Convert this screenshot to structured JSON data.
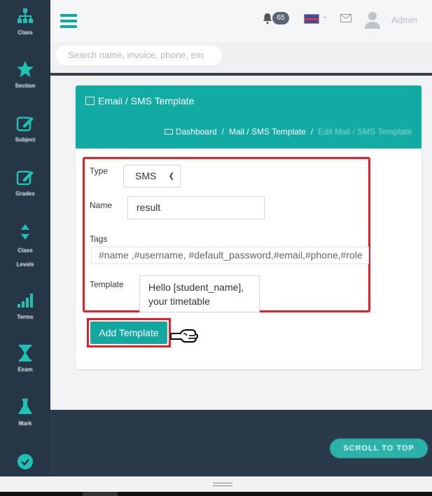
{
  "sidebar": {
    "items": [
      {
        "label": "Class",
        "icon": "class-hierarchy-icon"
      },
      {
        "label": "Section",
        "icon": "star-icon"
      },
      {
        "label": "Subject",
        "icon": "edit-icon"
      },
      {
        "label": "Grades",
        "icon": "edit-icon"
      },
      {
        "label_line1": "Class",
        "label_line2": "Levels",
        "icon": "sort-arrows-icon"
      },
      {
        "label": "Terms",
        "icon": "signal-bars-icon"
      },
      {
        "label": "Exam",
        "icon": "hourglass-icon"
      },
      {
        "label": "Mark",
        "icon": "flask-icon"
      },
      {
        "icon": "check-circle-icon"
      }
    ]
  },
  "topbar": {
    "notification_count": "65",
    "admin_label": "Admin",
    "accent_color": "#14a7a0"
  },
  "search": {
    "placeholder": "Search name, invoice, phone, em"
  },
  "card": {
    "title": "Email / SMS Template",
    "breadcrumb": {
      "dashboard": "Dashboard",
      "mail": "Mail / SMS Template",
      "current": "Edit Mail / SMS Template",
      "separator": "/"
    }
  },
  "form": {
    "type_label": "Type",
    "type_value": "SMS",
    "name_label": "Name",
    "name_value": "result",
    "tags_label": "Tags",
    "tags_value": "#name ,#username, #default_password,#email,#phone,#role",
    "template_label": "Template",
    "template_line1": "Hello [student_name],",
    "template_line2": "your timetable"
  },
  "actions": {
    "add_template": "Add Template"
  },
  "footer": {
    "scroll_to_top": "SCROLL TO TOP"
  }
}
